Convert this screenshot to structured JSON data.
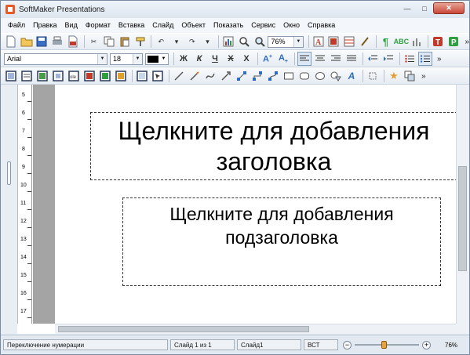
{
  "window": {
    "title": "SoftMaker Presentations",
    "buttons": {
      "minimize": "—",
      "maximize": "□",
      "close": "✕"
    }
  },
  "menu": [
    "Файл",
    "Правка",
    "Вид",
    "Формат",
    "Вставка",
    "Слайд",
    "Объект",
    "Показать",
    "Сервис",
    "Окно",
    "Справка"
  ],
  "toolbar1": {
    "zoom_value": "76%",
    "overflow": "»"
  },
  "toolbar2": {
    "font_name": "Arial",
    "font_size": "18",
    "text_color": "#000000",
    "overflow": "»"
  },
  "toolbar3": {
    "overflow": "»"
  },
  "ruler": {
    "numbers": [
      "5",
      "6",
      "7",
      "8",
      "9",
      "10",
      "11",
      "12",
      "13",
      "14",
      "15",
      "16",
      "17"
    ]
  },
  "slide": {
    "title_placeholder": "Щелкните для добавления заголовка",
    "subtitle_placeholder": "Щелкните для добавления подзаголовка"
  },
  "status": {
    "hint": "Переключение нумерации",
    "slide_pos": "Слайд  1 из 1",
    "slide_name": "Слайд1",
    "insert_mode": "ВСТ",
    "zoom_level": 0.45,
    "zoom_text": "76%",
    "zoom_minus": "−",
    "zoom_plus": "+"
  },
  "colors": {
    "accent_red": "#c0392b",
    "accent_green": "#2e9e3e",
    "ruler_gray": "#a4a4a4",
    "window_bg": "#dfe7f0"
  }
}
